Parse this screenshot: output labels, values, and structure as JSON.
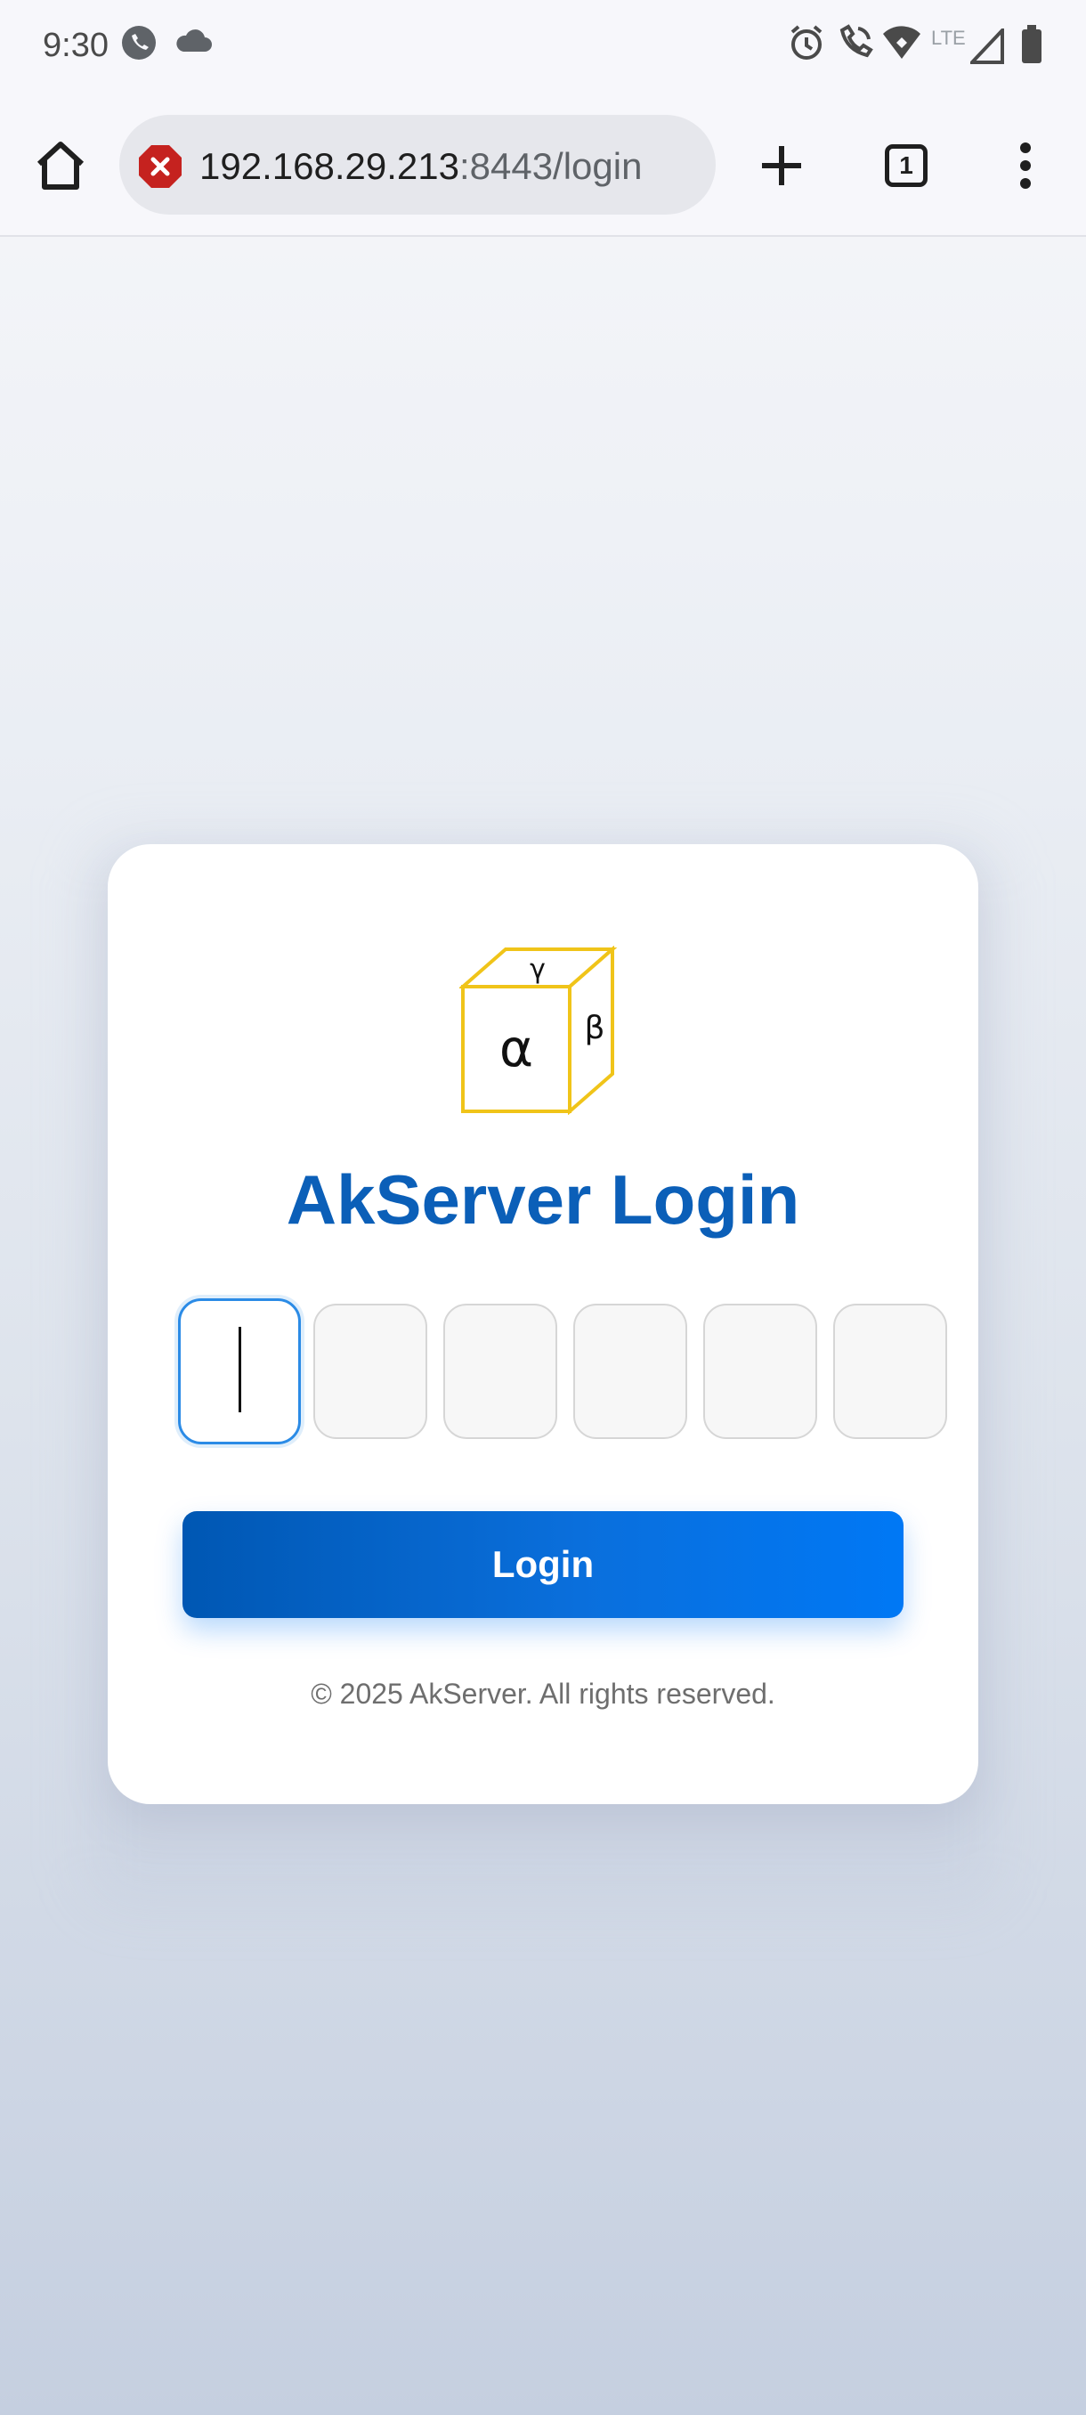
{
  "status_bar": {
    "time": "9:30",
    "network_label": "LTE",
    "icons": [
      "call-icon",
      "cloud-icon",
      "alarm-icon",
      "wifi-call-icon",
      "wifi-icon",
      "signal-icon",
      "battery-icon"
    ]
  },
  "browser": {
    "url_host": "192.168.29.213",
    "url_rest": ":8443/login",
    "tab_count": "1",
    "icons": [
      "home-icon",
      "not-secure-icon",
      "plus-icon",
      "tabs-icon",
      "more-vert-icon"
    ]
  },
  "login": {
    "logo_front": "α",
    "logo_top": "γ",
    "logo_side": "β",
    "title": "AkServer Login",
    "otp_digits": [
      "",
      "",
      "",
      "",
      "",
      ""
    ],
    "button_label": "Login",
    "footer": "© 2025 AkServer. All rights reserved."
  },
  "colors": {
    "title": "#0b5fb8",
    "button_start": "#0057b3",
    "button_end": "#0078f5",
    "logo_stroke": "#f0c419",
    "focus_border": "#2b8be6"
  }
}
